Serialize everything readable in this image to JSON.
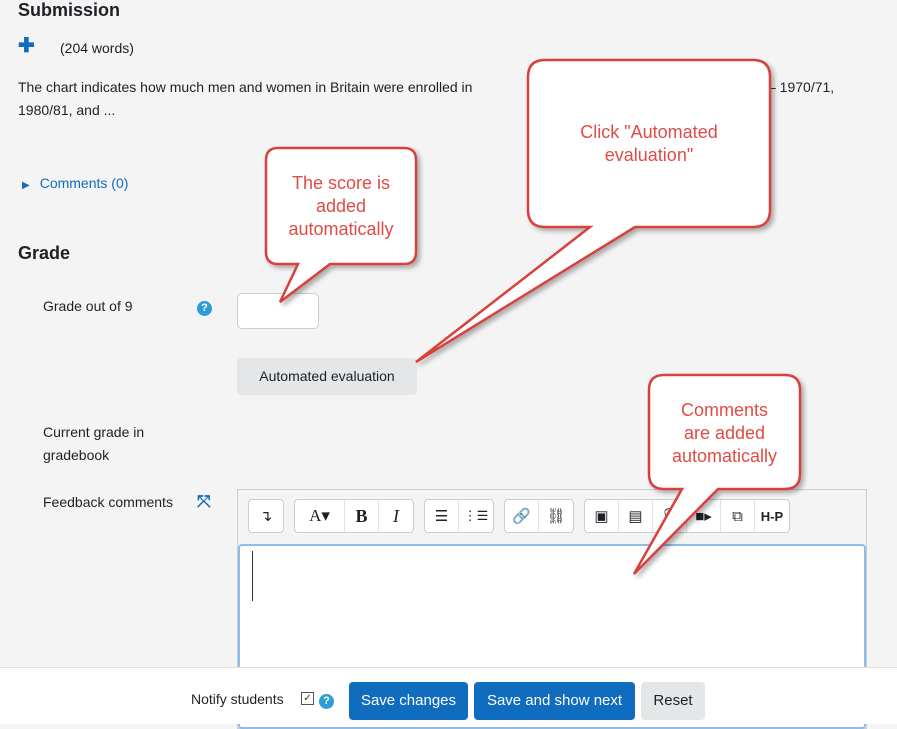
{
  "submission": {
    "heading": "Submission",
    "word_count": "(204 words)",
    "text_preview_line1": "The chart indicates how much men and women in Britain were enrolled in",
    "text_preview_line1_end": "– 1970/71,",
    "text_preview_line2": "1980/81, and ..."
  },
  "comments": {
    "label": "Comments (0)"
  },
  "grade": {
    "heading": "Grade",
    "grade_label": "Grade out of 9",
    "grade_value": "",
    "automated_button": "Automated evaluation",
    "current_grade_label_1": "Current grade in",
    "current_grade_label_2": "gradebook",
    "feedback_label": "Feedback comments"
  },
  "footer": {
    "notify_label": "Notify students",
    "save_changes": "Save changes",
    "save_next": "Save and show next",
    "reset": "Reset"
  },
  "callouts": {
    "score_1": "The score is",
    "score_2": "added",
    "score_3": "automatically",
    "click_1": "Click \"Automated",
    "click_2": "evaluation\"",
    "comments_1": "Comments",
    "comments_2": "are added",
    "comments_3": "automatically"
  },
  "colors": {
    "primary": "#0f6cbf",
    "callout_border": "#d9403a",
    "callout_text": "#e04b45"
  },
  "icons": {
    "toolbar": [
      "indent-icon",
      "font-style-icon",
      "bold-icon",
      "italic-icon",
      "unordered-list-icon",
      "ordered-list-icon",
      "link-icon",
      "unlink-icon",
      "image-icon",
      "media-icon",
      "record-audio-icon",
      "record-video-icon",
      "copy-icon",
      "h5p-icon"
    ]
  }
}
